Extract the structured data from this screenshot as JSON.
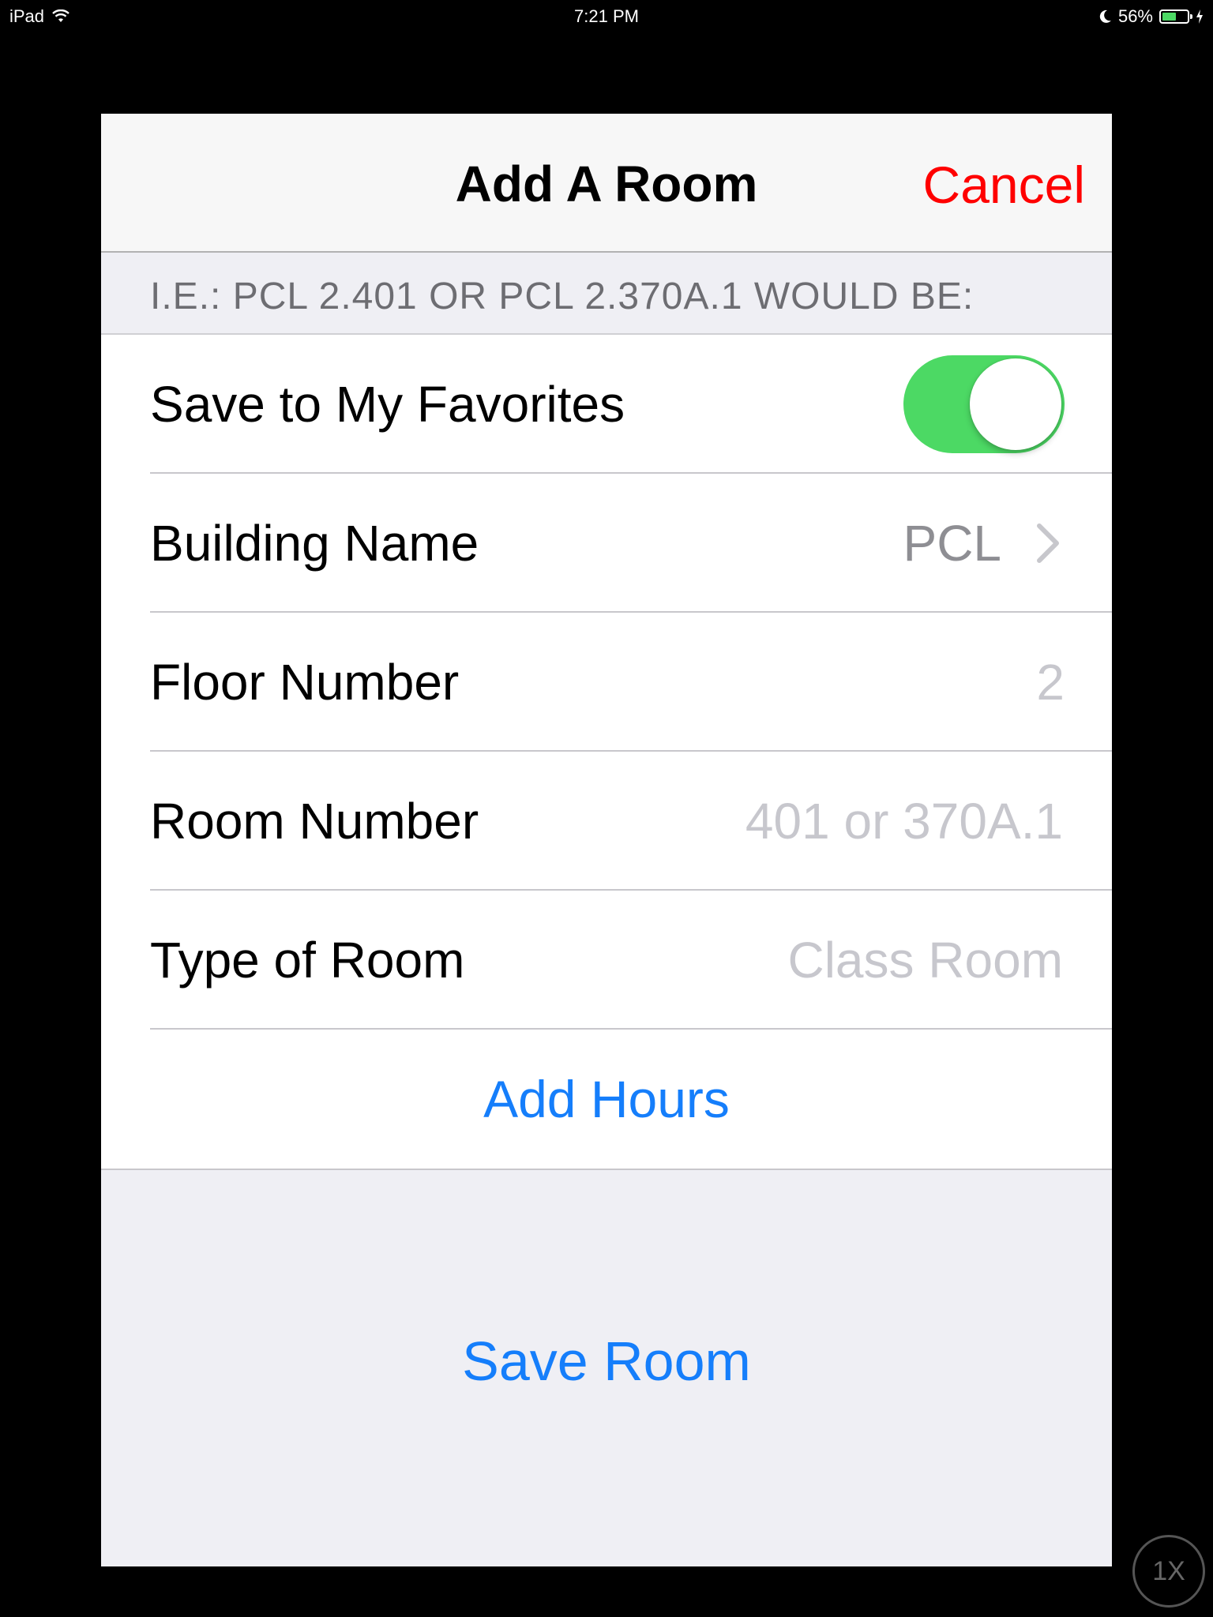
{
  "status_bar": {
    "device": "iPad",
    "time": "7:21 PM",
    "battery_percent": "56%",
    "battery_level": 0.56,
    "icons": [
      "wifi-icon",
      "moon-icon",
      "battery-icon",
      "charging-icon"
    ]
  },
  "nav": {
    "title": "Add A Room",
    "cancel_label": "Cancel",
    "cancel_color": "#ff0000"
  },
  "section": {
    "header": "I.E.: PCL 2.401 OR PCL 2.370A.1 WOULD BE:"
  },
  "form": {
    "favorites": {
      "label": "Save to My Favorites",
      "on": true
    },
    "building": {
      "label": "Building Name",
      "value": "PCL"
    },
    "floor": {
      "label": "Floor Number",
      "value": "2"
    },
    "room": {
      "label": "Room Number",
      "placeholder": "401 or 370A.1"
    },
    "type": {
      "label": "Type of Room",
      "placeholder": "Class Room"
    },
    "add_hours_label": "Add Hours"
  },
  "save_room_label": "Save Room",
  "zoom_badge": "1X",
  "colors": {
    "accent": "#157efb",
    "toggle_on": "#4cd964",
    "destructive": "#ff0000"
  }
}
